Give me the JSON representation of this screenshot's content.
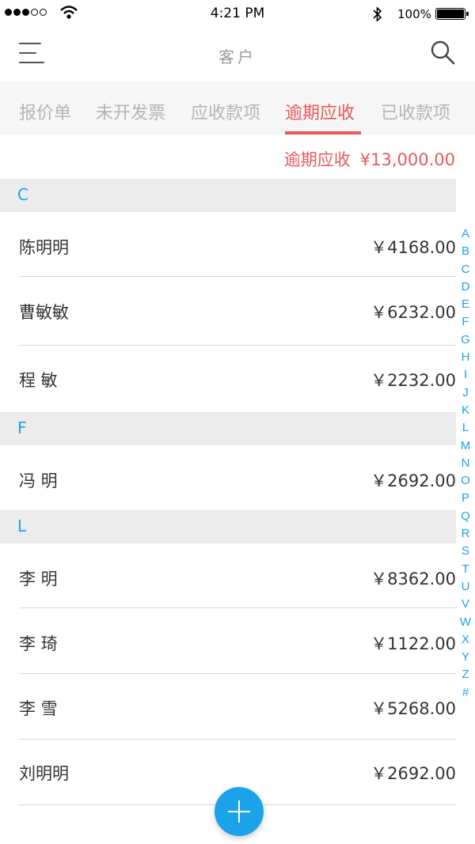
{
  "status_bar": {
    "time": "4:21 PM",
    "battery": "100%"
  },
  "nav": {
    "title": "客户",
    "menu_icon": "hamburger-menu-icon",
    "search_icon": "search-icon"
  },
  "tabs": [
    {
      "label": "报价单"
    },
    {
      "label": "未开发票"
    },
    {
      "label": "应收款项"
    },
    {
      "label": "逾期应收",
      "active": true
    },
    {
      "label": "已收款项"
    }
  ],
  "summary": {
    "label": "逾期应收",
    "amount": "¥13,000.00"
  },
  "sections": [
    {
      "letter": "C",
      "rows": [
        {
          "name": "陈明明",
          "amount": "￥4168.00"
        },
        {
          "name": "曹敏敏",
          "amount": "￥6232.00"
        },
        {
          "name": "程 敏",
          "amount": "￥2232.00"
        }
      ]
    },
    {
      "letter": "F",
      "rows": [
        {
          "name": "冯 明",
          "amount": "￥2692.00"
        }
      ]
    },
    {
      "letter": "L",
      "rows": [
        {
          "name": "李 明",
          "amount": "￥8362.00"
        },
        {
          "name": "李 琦",
          "amount": "￥1122.00"
        },
        {
          "name": "李 雪",
          "amount": "￥5268.00"
        },
        {
          "name": "刘明明",
          "amount": "￥2692.00"
        }
      ]
    }
  ],
  "index_letters": [
    "A",
    "B",
    "C",
    "D",
    "E",
    "F",
    "G",
    "H",
    "I",
    "J",
    "K",
    "L",
    "M",
    "N",
    "O",
    "P",
    "Q",
    "R",
    "S",
    "T",
    "U",
    "V",
    "W",
    "X",
    "Y",
    "Z",
    "#"
  ],
  "fab": {
    "icon": "plus-icon"
  },
  "colors": {
    "accent": "#1aa3e8",
    "highlight": "#e55a5a"
  }
}
